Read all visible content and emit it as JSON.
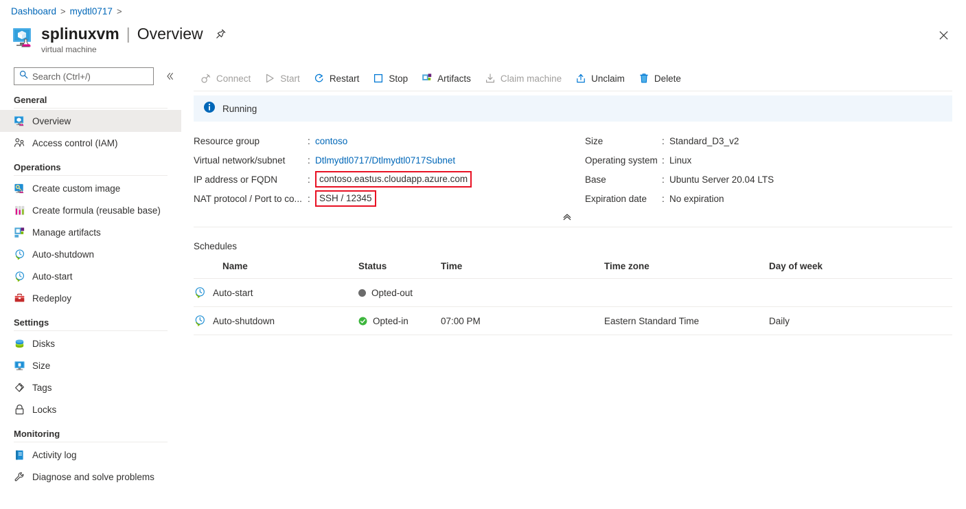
{
  "breadcrumb": {
    "items": [
      {
        "label": "Dashboard"
      },
      {
        "label": "mydtl0717"
      }
    ],
    "separator": ">"
  },
  "header": {
    "resource_name": "splinuxvm",
    "pipe": "|",
    "section": "Overview",
    "subtitle": "virtual machine",
    "icon": "virtual-machine-icon",
    "pin_icon": "pin-icon",
    "close_icon": "close-icon"
  },
  "search": {
    "placeholder": "Search (Ctrl+/)",
    "value": "",
    "icon": "search-icon",
    "collapse_icon": "chevron-double-left-icon"
  },
  "sidebar": {
    "groups": [
      {
        "title": "General",
        "items": [
          {
            "label": "Overview",
            "icon": "virtual-machine-icon",
            "selected": true
          },
          {
            "label": "Access control (IAM)",
            "icon": "people-icon",
            "selected": false
          }
        ]
      },
      {
        "title": "Operations",
        "items": [
          {
            "label": "Create custom image",
            "icon": "custom-image-icon",
            "selected": false
          },
          {
            "label": "Create formula (reusable base)",
            "icon": "formula-icon",
            "selected": false
          },
          {
            "label": "Manage artifacts",
            "icon": "artifacts-icon",
            "selected": false
          },
          {
            "label": "Auto-shutdown",
            "icon": "clock-icon",
            "selected": false
          },
          {
            "label": "Auto-start",
            "icon": "clock-icon",
            "selected": false
          },
          {
            "label": "Redeploy",
            "icon": "toolbox-icon",
            "selected": false
          }
        ]
      },
      {
        "title": "Settings",
        "items": [
          {
            "label": "Disks",
            "icon": "disks-icon",
            "selected": false
          },
          {
            "label": "Size",
            "icon": "monitor-icon",
            "selected": false
          },
          {
            "label": "Tags",
            "icon": "tag-icon",
            "selected": false
          },
          {
            "label": "Locks",
            "icon": "lock-icon",
            "selected": false
          }
        ]
      },
      {
        "title": "Monitoring",
        "items": [
          {
            "label": "Activity log",
            "icon": "activity-log-icon",
            "selected": false
          },
          {
            "label": "Diagnose and solve problems",
            "icon": "wrench-icon",
            "selected": false
          }
        ]
      }
    ]
  },
  "toolbar": {
    "buttons": [
      {
        "label": "Connect",
        "icon": "connect-plug-icon",
        "disabled": true
      },
      {
        "label": "Start",
        "icon": "play-triangle-icon",
        "disabled": true
      },
      {
        "label": "Restart",
        "icon": "restart-arrow-icon",
        "disabled": false
      },
      {
        "label": "Stop",
        "icon": "stop-square-icon",
        "disabled": false
      },
      {
        "label": "Artifacts",
        "icon": "artifacts-icon",
        "disabled": false
      },
      {
        "label": "Claim machine",
        "icon": "download-arrow-icon",
        "disabled": true
      },
      {
        "label": "Unclaim",
        "icon": "upload-arrow-icon",
        "disabled": false
      },
      {
        "label": "Delete",
        "icon": "trash-icon",
        "disabled": false
      }
    ]
  },
  "status_banner": {
    "icon": "info-icon",
    "text": "Running",
    "background": "#f0f6fc",
    "icon_color": "#0067b8"
  },
  "properties": {
    "left": [
      {
        "key": "Resource group",
        "colon": ":",
        "value": "contoso",
        "style": "link"
      },
      {
        "key": "Virtual network/subnet",
        "colon": ":",
        "value": "Dtlmydtl0717/Dtlmydtl0717Subnet",
        "style": "link"
      },
      {
        "key": "IP address or FQDN",
        "colon": ":",
        "value": "contoso.eastus.cloudapp.azure.com",
        "style": "boxed"
      },
      {
        "key": "NAT protocol / Port to co...",
        "colon": ":",
        "value": "SSH / 12345",
        "style": "boxed"
      }
    ],
    "right": [
      {
        "key": "Size",
        "colon": ":",
        "value": "Standard_D3_v2",
        "style": "plain"
      },
      {
        "key": "Operating system",
        "colon": ":",
        "value": "Linux",
        "style": "plain"
      },
      {
        "key": "Base",
        "colon": ":",
        "value": "Ubuntu Server 20.04 LTS",
        "style": "plain"
      },
      {
        "key": "Expiration date",
        "colon": ":",
        "value": "No expiration",
        "style": "plain"
      }
    ],
    "collapse_icon": "chevron-double-up-icon",
    "highlight_color": "#e81123"
  },
  "schedules": {
    "title": "Schedules",
    "columns": [
      "Name",
      "Status",
      "Time",
      "Time zone",
      "Day of week"
    ],
    "rows": [
      {
        "icon": "schedule-clock-icon",
        "name": "Auto-start",
        "status": "Opted-out",
        "status_icon": "gray-dot-icon",
        "time": "",
        "timezone": "",
        "day_of_week": ""
      },
      {
        "icon": "schedule-clock-icon",
        "name": "Auto-shutdown",
        "status": "Opted-in",
        "status_icon": "green-check-icon",
        "time": "07:00 PM",
        "timezone": "Eastern Standard Time",
        "day_of_week": "Daily"
      }
    ]
  },
  "colors": {
    "link": "#0067b8",
    "accent": "#0078d4",
    "highlight": "#e81123",
    "success": "#3db63d",
    "neutral": "#6b6b6b"
  }
}
